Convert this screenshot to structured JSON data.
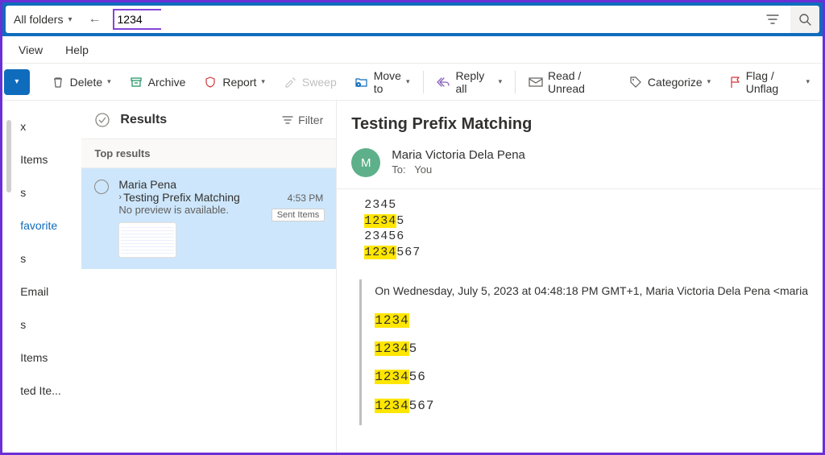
{
  "search": {
    "folder_label": "All folders",
    "value": "1234"
  },
  "menubar": {
    "view": "View",
    "help": "Help"
  },
  "ribbon": {
    "delete": "Delete",
    "archive": "Archive",
    "report": "Report",
    "sweep": "Sweep",
    "moveto": "Move to",
    "replyall": "Reply all",
    "readunread": "Read / Unread",
    "categorize": "Categorize",
    "flag": "Flag / Unflag"
  },
  "folders": {
    "items": [
      "x",
      "Items",
      "s",
      "favorite",
      "s",
      "Email",
      "s",
      "Items",
      "ted Ite..."
    ]
  },
  "list": {
    "title": "Results",
    "filter": "Filter",
    "subhead": "Top results",
    "item": {
      "sender": "Maria Pena",
      "subject": "Testing Prefix Matching",
      "preview": "No preview is available.",
      "time": "4:53 PM",
      "badge": "Sent Items"
    }
  },
  "reading": {
    "subject": "Testing Prefix Matching",
    "avatar_initial": "M",
    "from": "Maria Victoria Dela Pena",
    "to_label": "To:",
    "to_value": "You",
    "lines": [
      {
        "pre": "",
        "hl": "",
        "rest": "2345"
      },
      {
        "pre": "",
        "hl": "1234",
        "rest": "5"
      },
      {
        "pre": "",
        "hl": "",
        "rest": "23456"
      },
      {
        "pre": "",
        "hl": "1234",
        "rest": "567"
      }
    ],
    "quoted_header": "On Wednesday, July 5, 2023 at 04:48:18 PM GMT+1, Maria Victoria Dela Pena <maria",
    "quoted_lines": [
      {
        "hl": "1234",
        "rest": ""
      },
      {
        "hl": "1234",
        "rest": "5"
      },
      {
        "hl": "1234",
        "rest": "56"
      },
      {
        "hl": "1234",
        "rest": "567"
      }
    ]
  }
}
